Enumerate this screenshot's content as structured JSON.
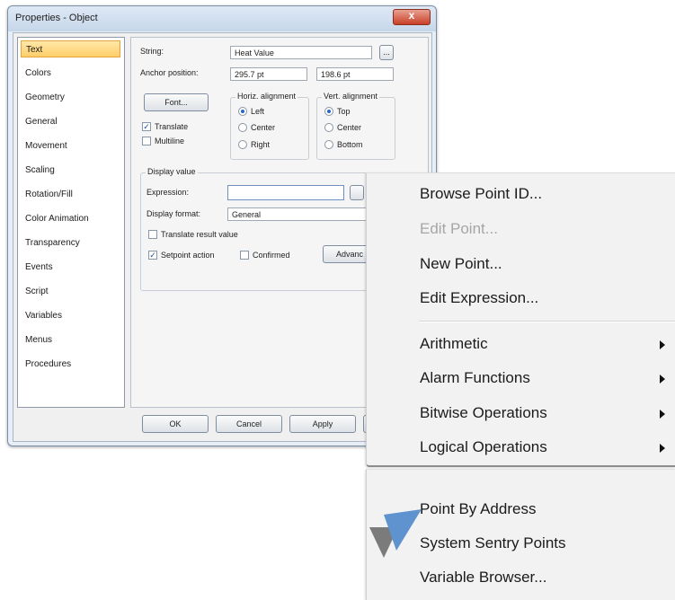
{
  "dialog": {
    "title": "Properties - Object",
    "close_label": "x",
    "nav_items": [
      {
        "label": "Text",
        "selected": true
      },
      {
        "label": "Colors"
      },
      {
        "label": "Geometry"
      },
      {
        "label": "General"
      },
      {
        "label": "Movement"
      },
      {
        "label": "Scaling"
      },
      {
        "label": "Rotation/Fill"
      },
      {
        "label": "Color Animation"
      },
      {
        "label": "Transparency"
      },
      {
        "label": "Events"
      },
      {
        "label": "Script"
      },
      {
        "label": "Variables"
      },
      {
        "label": "Menus"
      },
      {
        "label": "Procedures"
      }
    ],
    "panel": {
      "string_label": "String:",
      "string_value": "Heat Value",
      "string_browse": "...",
      "anchor_label": "Anchor position:",
      "anchor_x": "295.7 pt",
      "anchor_y": "198.6 pt",
      "font_button": "Font...",
      "translate_label": "Translate",
      "translate_checked": true,
      "multiline_label": "Multiline",
      "multiline_checked": false,
      "horiz_title": "Horiz. alignment",
      "horiz_options": [
        "Left",
        "Center",
        "Right"
      ],
      "horiz_selected": "Left",
      "vert_title": "Vert. alignment",
      "vert_options": [
        "Top",
        "Center",
        "Bottom"
      ],
      "vert_selected": "Top",
      "display_value_title": "Display value",
      "expression_label": "Expression:",
      "expression_value": "",
      "display_format_label": "Display format:",
      "display_format_value": "General",
      "translate_result_label": "Translate result value",
      "translate_result_checked": false,
      "setpoint_label": "Setpoint action",
      "setpoint_checked": true,
      "confirmed_label": "Confirmed",
      "confirmed_checked": false,
      "advanced_button": "Advanc"
    },
    "buttons": {
      "ok": "OK",
      "cancel": "Cancel",
      "apply": "Apply"
    }
  },
  "context_menu": {
    "items": [
      {
        "label": "Browse Point ID...",
        "enabled": true
      },
      {
        "label": "Edit Point...",
        "enabled": false
      },
      {
        "label": "New Point...",
        "enabled": true
      },
      {
        "label": "Edit Expression...",
        "enabled": true
      }
    ],
    "submenus": [
      {
        "label": "Arithmetic"
      },
      {
        "label": "Alarm Functions"
      },
      {
        "label": "Bitwise Operations"
      },
      {
        "label": "Logical Operations"
      }
    ]
  },
  "context_menu_2": {
    "items": [
      {
        "label": "Point By Address"
      },
      {
        "label": "System Sentry Points"
      },
      {
        "label": "Variable Browser..."
      }
    ]
  },
  "colors": {
    "selection_highlight": "#ffce6a",
    "cursor_blue": "#5e93cf",
    "cursor_gray": "#7b7b7b"
  }
}
